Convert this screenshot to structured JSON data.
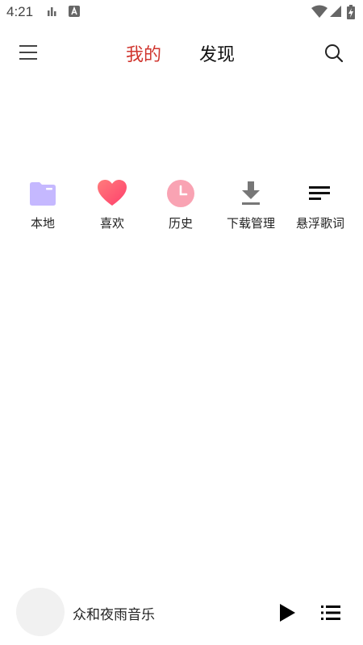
{
  "status_bar": {
    "time": "4:21",
    "icons": [
      "signal-bars-icon",
      "app-notification-icon",
      "wifi-icon",
      "cell-signal-icon",
      "battery-charging-icon"
    ]
  },
  "header": {
    "menu_icon": "hamburger-menu-icon",
    "tabs": [
      {
        "label": "我的",
        "active": true
      },
      {
        "label": "发现",
        "active": false
      }
    ],
    "search_icon": "search-icon",
    "accent_color": "#d0362f"
  },
  "actions": [
    {
      "label": "本地",
      "icon": "folder-icon",
      "color": "#c5b8ff"
    },
    {
      "label": "喜欢",
      "icon": "heart-icon",
      "color": "#ff5b72"
    },
    {
      "label": "历史",
      "icon": "clock-icon",
      "color": "#f9a3b3"
    },
    {
      "label": "下载管理",
      "icon": "download-icon",
      "color": "#777777"
    },
    {
      "label": "悬浮歌词",
      "icon": "lyrics-lines-icon",
      "color": "#111111"
    }
  ],
  "player": {
    "title": "众和夜雨音乐",
    "play_icon": "play-icon",
    "playlist_icon": "playlist-icon"
  }
}
